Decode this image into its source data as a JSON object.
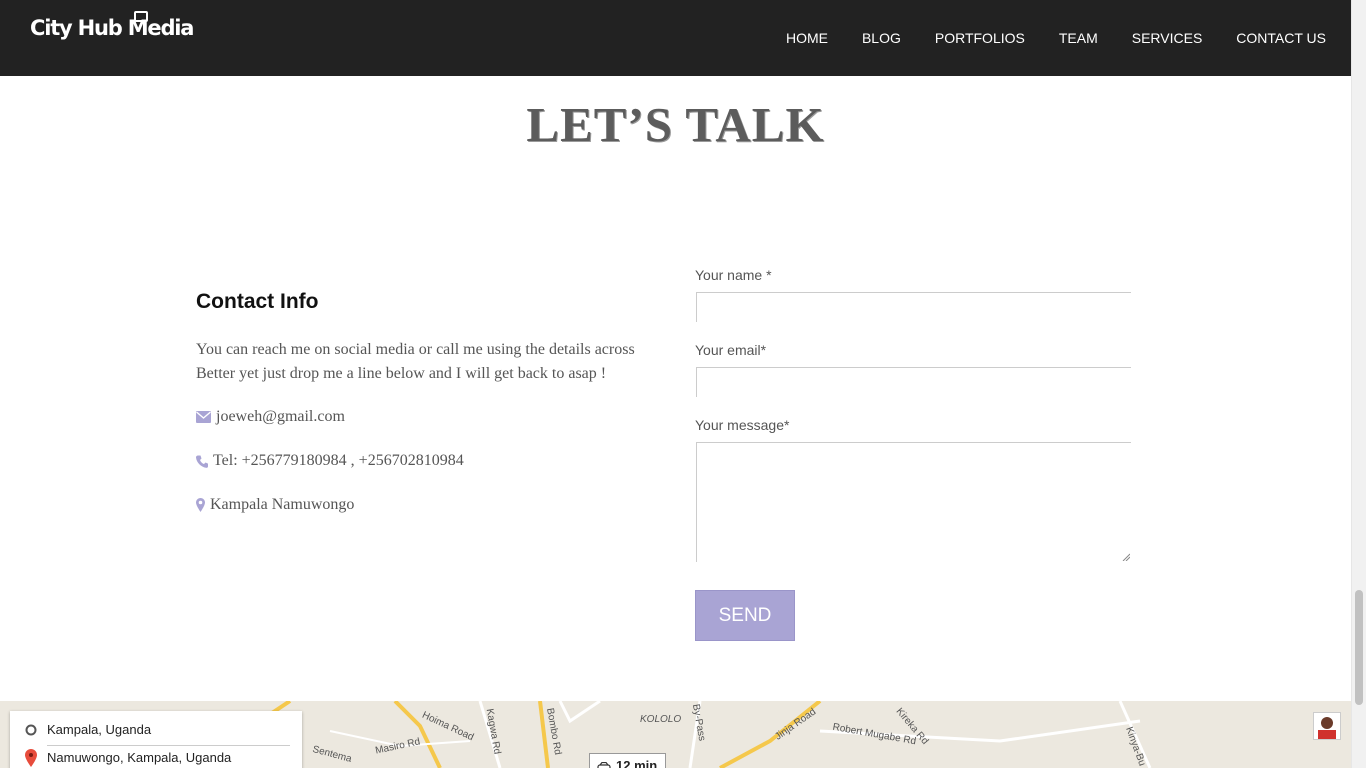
{
  "header": {
    "logo": "City Hub Media",
    "nav": [
      "HOME",
      "BLOG",
      "PORTFOLIOS",
      "TEAM",
      "SERVICES",
      "CONTACT US"
    ]
  },
  "hero": {
    "title": "LET’S TALK"
  },
  "contact_info": {
    "heading": "Contact Info",
    "description": "You can reach me on social media or call me using the details across Better yet just drop me a line below and I will get back to asap !",
    "email": "joeweh@gmail.com",
    "phone": "Tel: +256779180984 , +256702810984",
    "location": "Kampala Namuwongo"
  },
  "form": {
    "name_label": "Your name *",
    "email_label": "Your email*",
    "message_label": "Your message*",
    "send_label": "SEND"
  },
  "map": {
    "origin": "Kampala, Uganda",
    "destination": "Namuwongo, Kampala, Uganda",
    "eta": "12 min",
    "labels": [
      "Hoima Road",
      "Masiro Rd",
      "Sentema",
      "Bombo Rd",
      "Kagwa Rd",
      "KOLOLO",
      "Jinja Road",
      "Robert Mugabe Rd",
      "Kireka Rd",
      "Kinya-Bu",
      "By-Pass"
    ]
  },
  "colors": {
    "header_bg": "#222222",
    "accent": "#a9a4d4",
    "icon": "#a9a4d4"
  }
}
